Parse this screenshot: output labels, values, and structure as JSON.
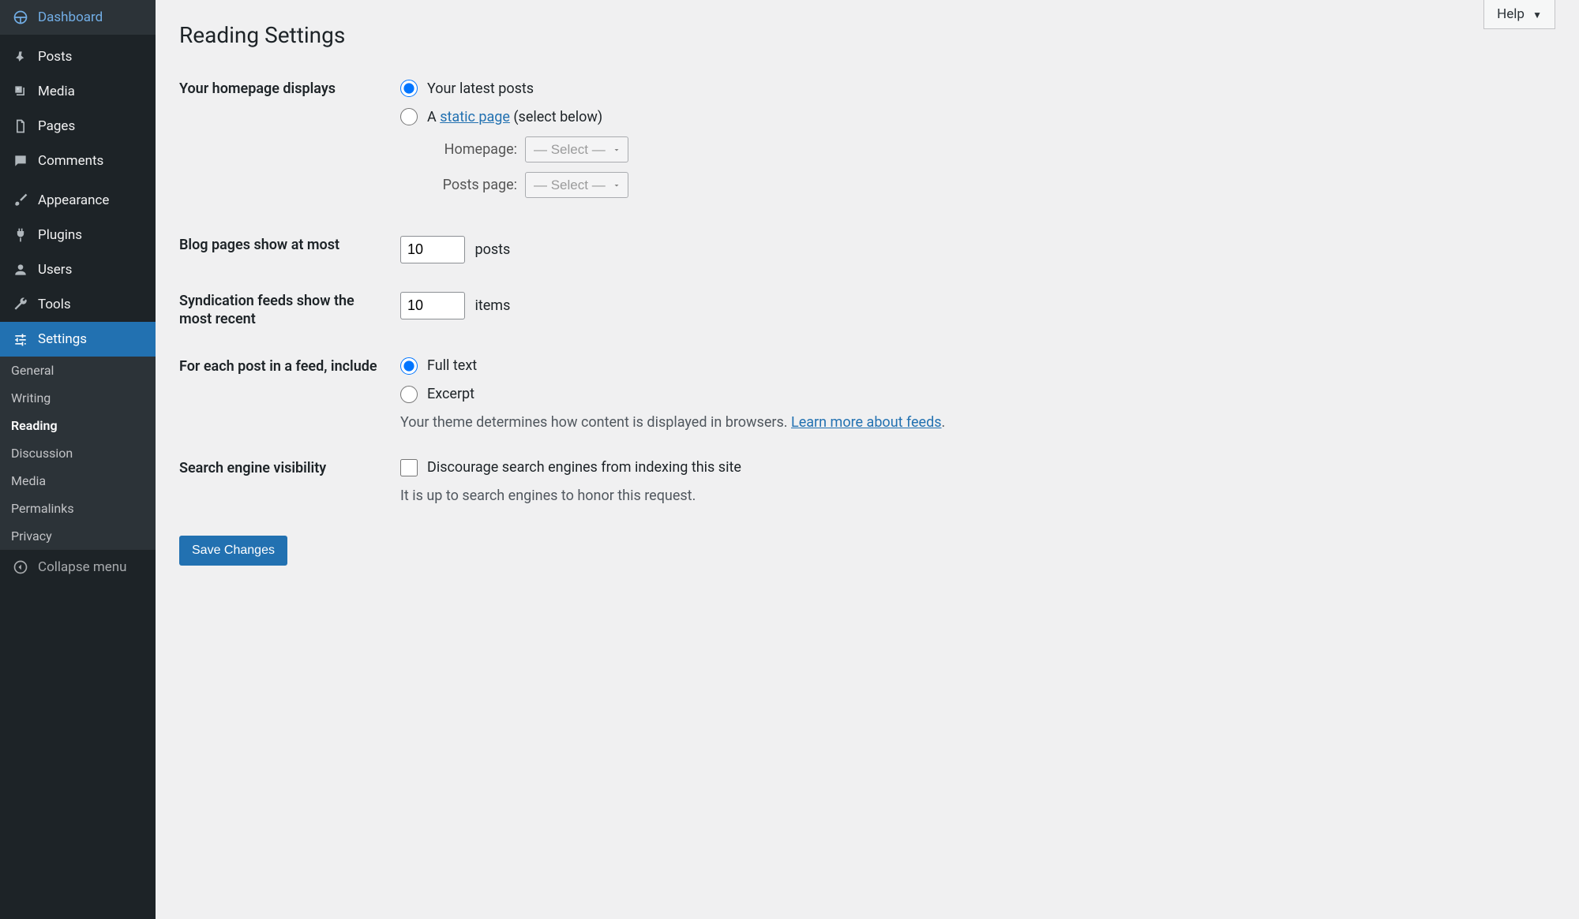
{
  "help": "Help",
  "sidebar": {
    "items": [
      {
        "label": "Dashboard",
        "icon": "dashboard"
      },
      {
        "label": "Posts",
        "icon": "pin"
      },
      {
        "label": "Media",
        "icon": "media"
      },
      {
        "label": "Pages",
        "icon": "page"
      },
      {
        "label": "Comments",
        "icon": "comment"
      },
      {
        "label": "Appearance",
        "icon": "brush"
      },
      {
        "label": "Plugins",
        "icon": "plug"
      },
      {
        "label": "Users",
        "icon": "user"
      },
      {
        "label": "Tools",
        "icon": "wrench"
      },
      {
        "label": "Settings",
        "icon": "sliders",
        "active": true
      }
    ],
    "submenu": [
      {
        "label": "General"
      },
      {
        "label": "Writing"
      },
      {
        "label": "Reading",
        "active": true
      },
      {
        "label": "Discussion"
      },
      {
        "label": "Media"
      },
      {
        "label": "Permalinks"
      },
      {
        "label": "Privacy"
      }
    ],
    "collapse": "Collapse menu"
  },
  "page": {
    "title": "Reading Settings",
    "homepage_displays": {
      "label": "Your homepage displays",
      "latest_posts": "Your latest posts",
      "static_prefix": "A ",
      "static_link": "static page",
      "static_suffix": " (select below)",
      "homepage_label": "Homepage:",
      "posts_page_label": "Posts page:",
      "select_placeholder": "— Select —"
    },
    "blog_pages": {
      "label": "Blog pages show at most",
      "value": "10",
      "suffix": "posts"
    },
    "syndication": {
      "label": "Syndication feeds show the most recent",
      "value": "10",
      "suffix": "items"
    },
    "feed_include": {
      "label": "For each post in a feed, include",
      "full_text": "Full text",
      "excerpt": "Excerpt",
      "description_prefix": "Your theme determines how content is displayed in browsers. ",
      "description_link": "Learn more about feeds",
      "description_suffix": "."
    },
    "search_visibility": {
      "label": "Search engine visibility",
      "checkbox_label": "Discourage search engines from indexing this site",
      "description": "It is up to search engines to honor this request."
    },
    "save_button": "Save Changes"
  }
}
